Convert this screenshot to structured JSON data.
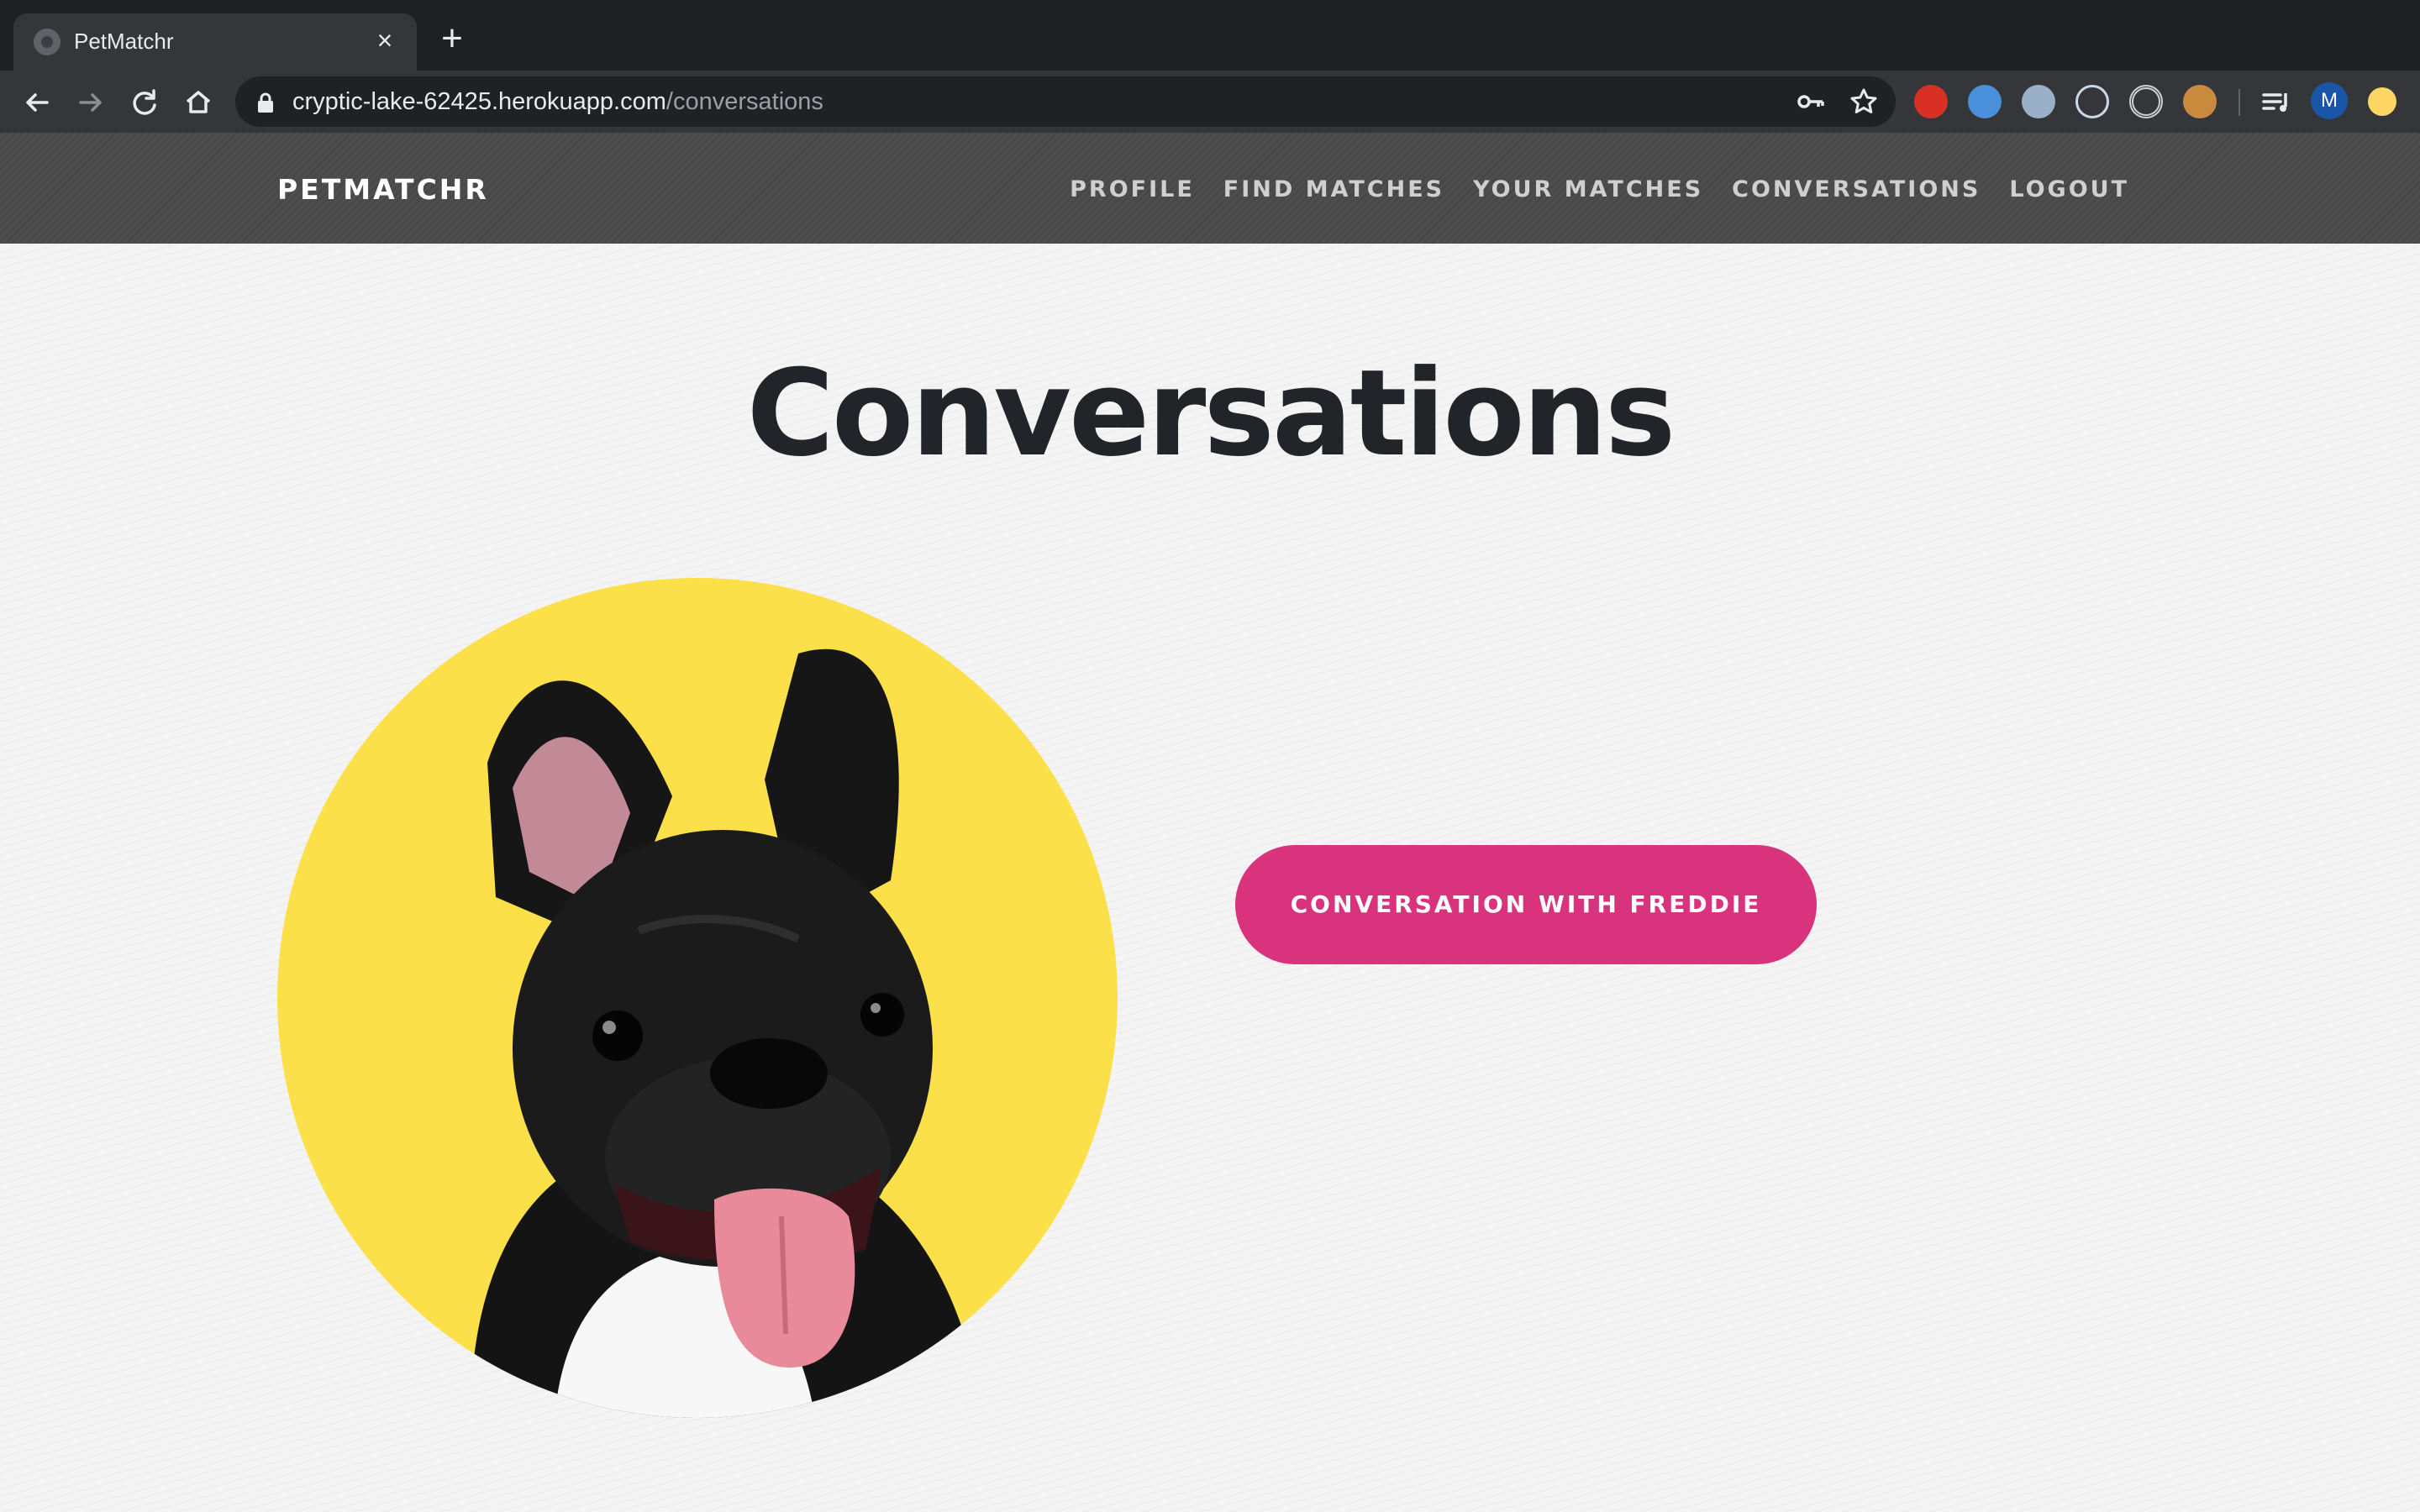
{
  "browser": {
    "tab_title": "PetMatchr",
    "tab_close": "×",
    "new_tab": "+",
    "url_host": "cryptic-lake-62425.herokuapp.com",
    "url_path": "/conversations",
    "profile_initial": "M",
    "icons": [
      "back-icon",
      "forward-icon",
      "reload-icon",
      "home-icon",
      "lock-icon",
      "key-icon",
      "star-icon",
      "reading-list-icon"
    ]
  },
  "nav": {
    "brand": "PETMATCHR",
    "links": [
      "PROFILE",
      "FIND MATCHES",
      "YOUR MATCHES",
      "CONVERSATIONS",
      "LOGOUT"
    ]
  },
  "page": {
    "title": "Conversations",
    "conversations": [
      {
        "button_label": "CONVERSATION WITH FREDDIE"
      }
    ]
  },
  "colors": {
    "accent": "#d8337c",
    "photo_background": "#fbe04a",
    "navbar": "#4a4a4a",
    "title": "#212529"
  }
}
